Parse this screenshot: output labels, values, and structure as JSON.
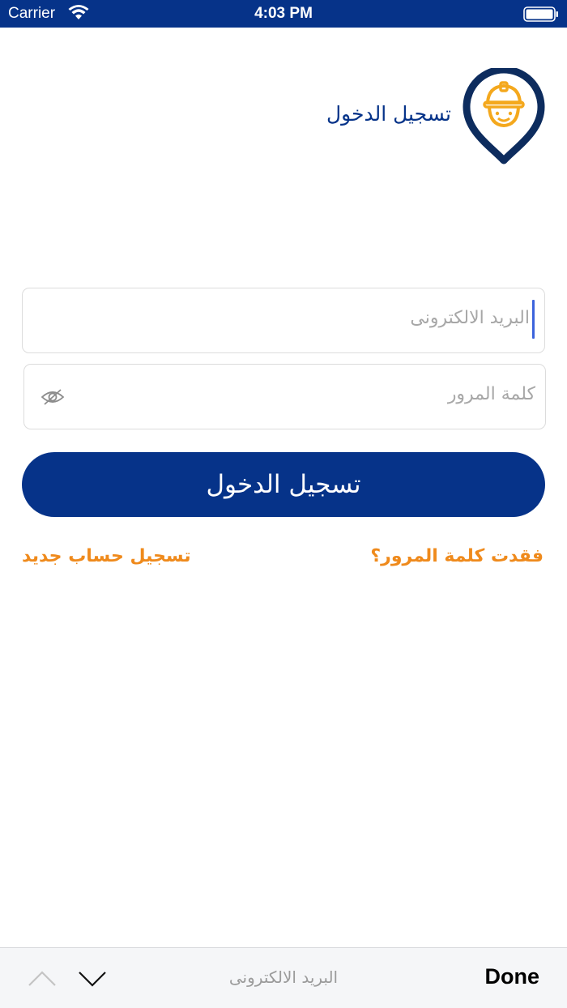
{
  "status_bar": {
    "carrier": "Carrier",
    "time": "4:03 PM",
    "background_color": "#063389"
  },
  "header": {
    "title": "تسجيل الدخول",
    "logo_icon": "worker-helmet-pin-icon",
    "title_color": "#063389"
  },
  "form": {
    "email": {
      "placeholder": "البريد الالكترونى",
      "value": "",
      "focused": true
    },
    "password": {
      "placeholder": "كلمة المرور",
      "value": "",
      "visibility_icon": "eye-slash-icon"
    },
    "login_button_label": "تسجيل الدخول",
    "accent_color": "#063389"
  },
  "links": {
    "forgot_password": "فقدت كلمة المرور؟",
    "register": "تسجيل حساب جديد",
    "color": "#ef8a1c"
  },
  "keyboard_accessory": {
    "field_label": "البريد الالكترونى",
    "done_label": "Done",
    "prev_icon": "chevron-up-icon",
    "next_icon": "chevron-down-icon"
  }
}
